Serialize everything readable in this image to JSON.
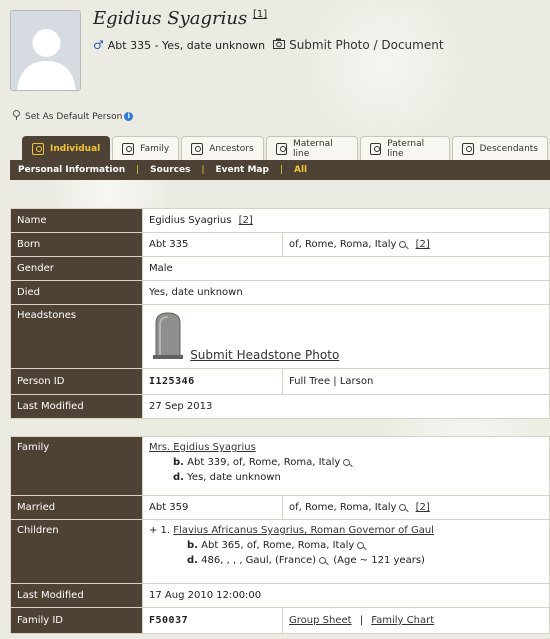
{
  "person": {
    "name": "Egidius Syagrius",
    "ref": "[1]",
    "gender_symbol": "♂",
    "summary": "Abt 335 - Yes, date unknown",
    "submit_photo": "Submit Photo / Document",
    "set_default": "Set As Default Person",
    "info_glyph": "i"
  },
  "tabs": [
    {
      "label": "Individual"
    },
    {
      "label": "Family"
    },
    {
      "label": "Ancestors"
    },
    {
      "label": "Maternal line"
    },
    {
      "label": "Paternal line"
    },
    {
      "label": "Descendants"
    }
  ],
  "subnav": {
    "items": [
      "Personal Information",
      "Sources",
      "Event Map",
      "All"
    ],
    "sep": "|"
  },
  "individual": {
    "name_label": "Name",
    "name_value": "Egidius Syagrius",
    "name_ref": "[2]",
    "born_label": "Born",
    "born_date": "Abt 335",
    "born_place": "of, Rome, Roma, Italy",
    "born_ref": "[2]",
    "gender_label": "Gender",
    "gender_value": "Male",
    "died_label": "Died",
    "died_value": "Yes, date unknown",
    "headstones_label": "Headstones",
    "headstone_link": "Submit Headstone Photo",
    "person_id_label": "Person ID",
    "person_id": "I125346",
    "tree_info": "Full Tree | Larson",
    "modified_label": "Last Modified",
    "modified_value": "27 Sep 2013"
  },
  "family": {
    "family_label": "Family",
    "spouse": "Mrs. Egidius Syagrius",
    "spouse_b_tag": "b.",
    "spouse_b": "Abt 339, of, Rome, Roma, Italy",
    "spouse_d_tag": "d.",
    "spouse_d": "Yes, date unknown",
    "married_label": "Married",
    "married_date": "Abt 359",
    "married_place": "of, Rome, Roma, Italy",
    "married_ref": "[2]",
    "children_label": "Children",
    "child_marker": "+ 1.",
    "child_name": "Flavius Africanus Syagrius, Roman Governor of Gaul",
    "child_b_tag": "b.",
    "child_b": "Abt 365, of, Rome, Roma, Italy",
    "child_d_tag": "d.",
    "child_d": "486, , , , Gaul, (France)",
    "child_age": "(Age ~ 121 years)",
    "modified_label": "Last Modified",
    "modified_value": "17 Aug 2010 12:00:00",
    "family_id_label": "Family ID",
    "family_id": "F50037",
    "group_sheet": "Group Sheet",
    "family_sep": "|",
    "family_chart": "Family Chart"
  },
  "colors": {
    "accent": "#f3c437",
    "label_bg": "#4e4235",
    "male": "#2b58b7",
    "info": "#2e7bd1"
  }
}
